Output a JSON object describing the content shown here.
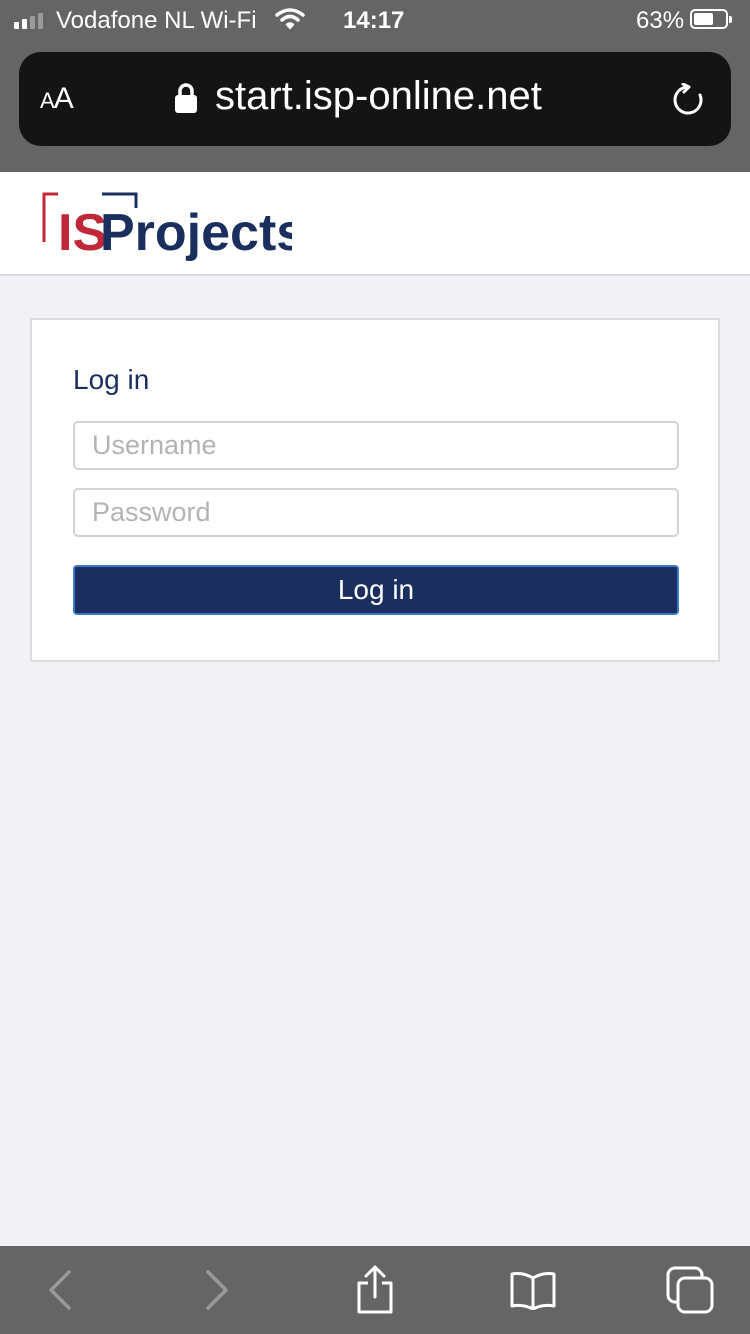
{
  "status_bar": {
    "carrier": "Vodafone NL Wi-Fi",
    "time": "14:17",
    "battery_percent": "63%",
    "battery_level": 0.63,
    "signal_bars_active": 2,
    "signal_bars_total": 4
  },
  "browser": {
    "text_size_label_small": "A",
    "text_size_label_large": "A",
    "url": "start.isp-online.net"
  },
  "site": {
    "logo_text_is": "IS",
    "logo_text_projects": "Projects",
    "logo_colors": {
      "red": "#c0283a",
      "navy": "#1b2f5f"
    }
  },
  "login": {
    "title": "Log in",
    "username_placeholder": "Username",
    "password_placeholder": "Password",
    "submit_label": "Log in"
  },
  "toolbar": {
    "icons": [
      "back-icon",
      "forward-icon",
      "share-icon",
      "bookmarks-icon",
      "tabs-icon"
    ]
  },
  "colors": {
    "chrome_gray": "#656565",
    "url_bar_bg": "#141414",
    "page_bg": "#f2f2f6",
    "button_bg": "#1a2f5e",
    "button_border": "#3c78c8"
  }
}
